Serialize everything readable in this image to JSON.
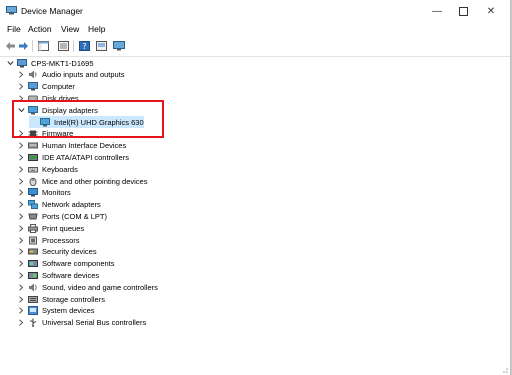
{
  "window": {
    "title": "Device Manager"
  },
  "menu": [
    "File",
    "Action",
    "View",
    "Help"
  ],
  "tree": {
    "root": "CPS-MKT1-D1695",
    "categories": [
      {
        "label": "Audio inputs and outputs",
        "icon": "speaker-icon",
        "expanded": false
      },
      {
        "label": "Computer",
        "icon": "computer-icon",
        "expanded": false
      },
      {
        "label": "Disk drives",
        "icon": "disk-icon",
        "expanded": false
      },
      {
        "label": "Display adapters",
        "icon": "display-icon",
        "expanded": true,
        "children": [
          "Intel(R) UHD Graphics 630"
        ]
      },
      {
        "label": "Firmware",
        "icon": "chip-icon",
        "expanded": false
      },
      {
        "label": "Human Interface Devices",
        "icon": "hid-icon",
        "expanded": false
      },
      {
        "label": "IDE ATA/ATAPI controllers",
        "icon": "ide-icon",
        "expanded": false
      },
      {
        "label": "Keyboards",
        "icon": "keyboard-icon",
        "expanded": false
      },
      {
        "label": "Mice and other pointing devices",
        "icon": "mouse-icon",
        "expanded": false
      },
      {
        "label": "Monitors",
        "icon": "monitor-icon",
        "expanded": false
      },
      {
        "label": "Network adapters",
        "icon": "network-icon",
        "expanded": false
      },
      {
        "label": "Ports (COM & LPT)",
        "icon": "port-icon",
        "expanded": false
      },
      {
        "label": "Print queues",
        "icon": "printer-icon",
        "expanded": false
      },
      {
        "label": "Processors",
        "icon": "processor-icon",
        "expanded": false
      },
      {
        "label": "Security devices",
        "icon": "security-icon",
        "expanded": false
      },
      {
        "label": "Software components",
        "icon": "software-component-icon",
        "expanded": false
      },
      {
        "label": "Software devices",
        "icon": "software-device-icon",
        "expanded": false
      },
      {
        "label": "Sound, video and game controllers",
        "icon": "sound-icon",
        "expanded": false
      },
      {
        "label": "Storage controllers",
        "icon": "storage-icon",
        "expanded": false
      },
      {
        "label": "System devices",
        "icon": "system-icon",
        "expanded": false
      },
      {
        "label": "Universal Serial Bus controllers",
        "icon": "usb-icon",
        "expanded": false
      }
    ]
  },
  "colors": {
    "highlight": "#e8141c",
    "selection": "#cce8ff"
  }
}
